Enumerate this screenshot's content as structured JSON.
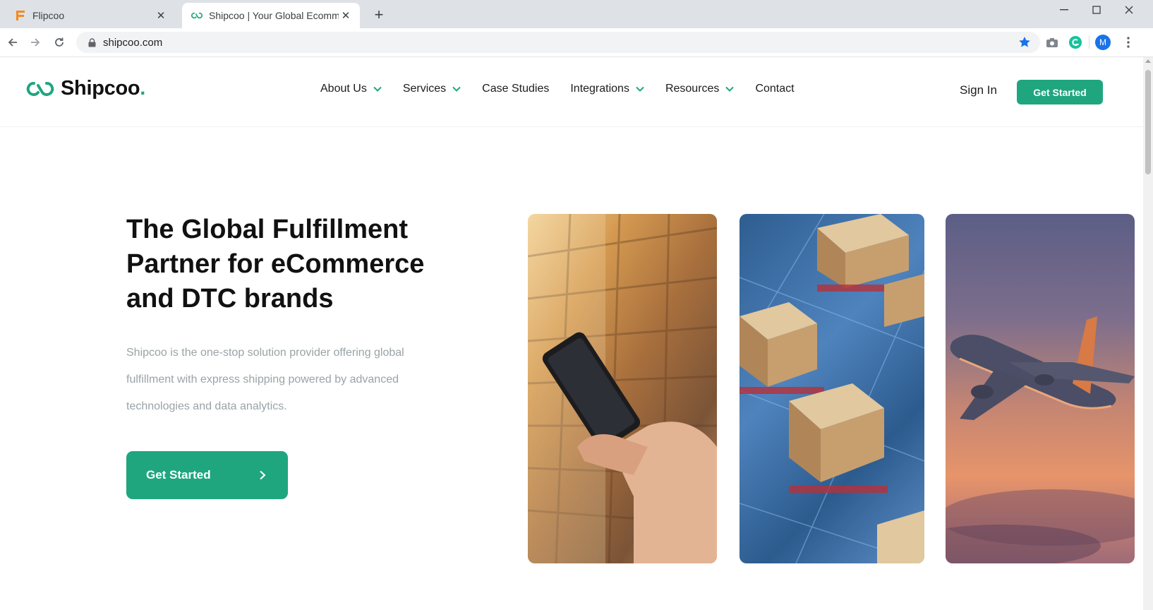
{
  "browser": {
    "tabs": [
      {
        "title": "Flipcoo",
        "favicon": "flipcoo-icon",
        "active": false
      },
      {
        "title": "Shipcoo | Your Global Ecomm",
        "favicon": "shipcoo-icon",
        "active": true
      }
    ],
    "url": "shipcoo.com",
    "profile_initial": "M"
  },
  "site": {
    "logo": {
      "text": "Shipcoo",
      "dot": "."
    },
    "nav": [
      {
        "label": "About Us",
        "dropdown": true
      },
      {
        "label": "Services",
        "dropdown": true
      },
      {
        "label": "Case Studies",
        "dropdown": false
      },
      {
        "label": "Integrations",
        "dropdown": true
      },
      {
        "label": "Resources",
        "dropdown": true
      },
      {
        "label": "Contact",
        "dropdown": false
      }
    ],
    "sign_in": "Sign In",
    "header_cta": "Get Started"
  },
  "hero": {
    "title_lines": [
      "The Global Fulfillment",
      "Partner for eCommerce",
      "and DTC brands"
    ],
    "subtitle_lines": [
      "Shipcoo is the one-stop solution provider offering global",
      "fulfillment with express shipping powered by advanced",
      "technologies and data analytics."
    ],
    "cta": "Get Started"
  },
  "colors": {
    "brand_green": "#1fa67f",
    "tabbar_bg": "#dee1e6",
    "subtitle_gray": "#9aa3a6"
  }
}
